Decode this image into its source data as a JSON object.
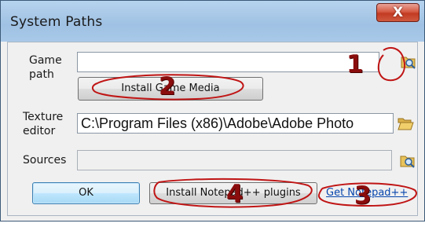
{
  "window": {
    "title": "System Paths",
    "close_glyph": "X"
  },
  "fields": {
    "game_path": {
      "label": "Game path",
      "value": "",
      "icon": "folder-search-icon"
    },
    "texture_editor": {
      "label": "Texture editor",
      "value": "C:\\Program Files (x86)\\Adobe\\Adobe Photo",
      "icon": "open-folder-icon"
    },
    "sources": {
      "label": "Sources",
      "value": "",
      "icon": "folder-search-icon"
    }
  },
  "buttons": {
    "install_game_media": "Install Game Media",
    "ok": "OK",
    "install_notepad_plugins": "Install Notepad++ plugins"
  },
  "links": {
    "get_notepad": "Get Notepad++"
  },
  "annotations": {
    "markers": [
      "1",
      "2",
      "3",
      "4"
    ],
    "color": "#c01515"
  }
}
